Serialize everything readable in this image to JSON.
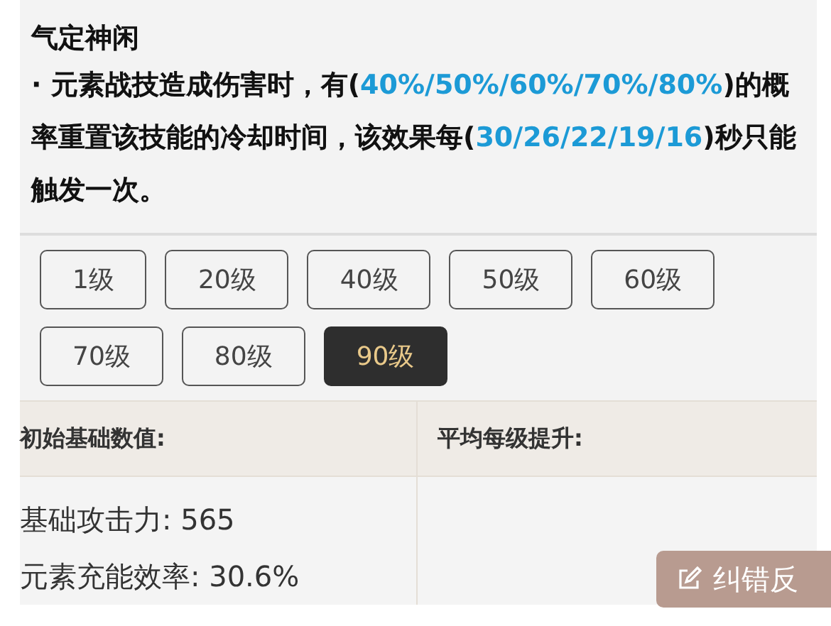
{
  "passive": {
    "title": "气定神闲",
    "description": [
      {
        "text": " · 元素战技造成伤害时，有(",
        "highlight": false
      },
      {
        "text": "40%/50%/60%/70%/80%",
        "highlight": true
      },
      {
        "text": ")的概率重置该技能的冷却时间，该效果每(",
        "highlight": false
      },
      {
        "text": "30/26/22/19/16",
        "highlight": true
      },
      {
        "text": ")秒只能触发一次。",
        "highlight": false
      }
    ]
  },
  "levels": [
    {
      "label": "1级",
      "selected": false
    },
    {
      "label": "20级",
      "selected": false
    },
    {
      "label": "40级",
      "selected": false
    },
    {
      "label": "50级",
      "selected": false
    },
    {
      "label": "60级",
      "selected": false
    },
    {
      "label": "70级",
      "selected": false
    },
    {
      "label": "80级",
      "selected": false
    },
    {
      "label": "90级",
      "selected": true
    }
  ],
  "stats_table": {
    "columns": [
      "初始基础数值:",
      "平均每级提升:"
    ],
    "base_stats": [
      "基础攻击力: 565",
      "元素充能效率: 30.6%"
    ]
  },
  "feedback_button": {
    "label": "纠错反"
  }
}
